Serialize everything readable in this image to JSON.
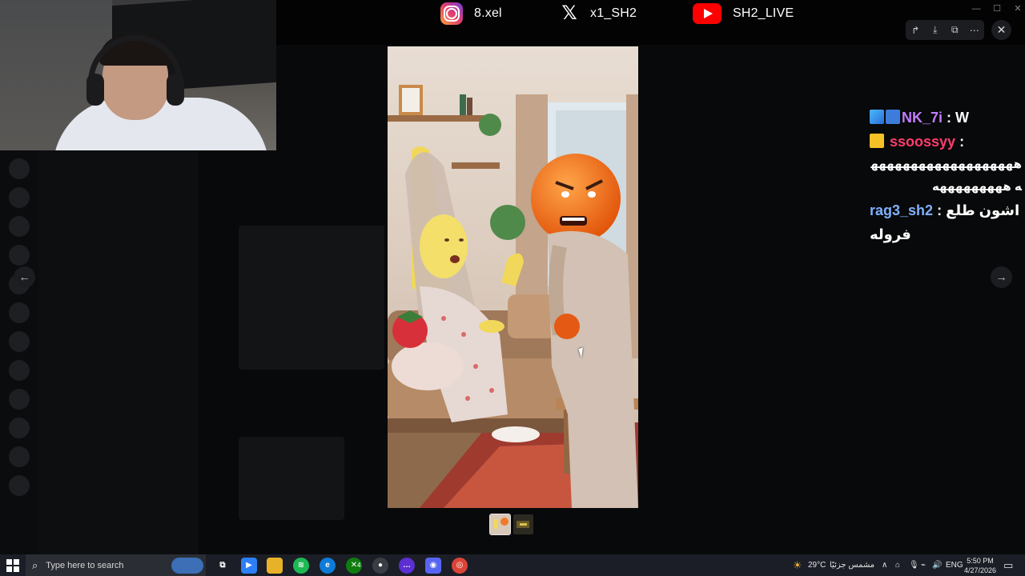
{
  "social": {
    "instagram": {
      "icon": "instagram-icon",
      "handle": "8.xel"
    },
    "x": {
      "icon": "x-twitter-icon",
      "handle": "x1_SH2"
    },
    "youtube": {
      "icon": "youtube-icon",
      "handle": "SH2_LIVE"
    }
  },
  "viewer": {
    "toolbar": [
      {
        "icon": "forward-icon",
        "glyph": "↱"
      },
      {
        "icon": "download-icon",
        "glyph": "⤓"
      },
      {
        "icon": "open-external-icon",
        "glyph": "⧉"
      },
      {
        "icon": "more-icon",
        "glyph": "⋯"
      }
    ],
    "close_glyph": "✕",
    "prev_glyph": "←",
    "next_glyph": "→"
  },
  "chat": [
    {
      "user": "NK_7i",
      "separator": " : ",
      "message": "W"
    },
    {
      "user": "ssoossyy",
      "separator": " :",
      "message": "هههههههههههههههههههه هههههههههه"
    },
    {
      "user": "rag3_sh2",
      "separator": " : ",
      "message": "اشون طلع فروله"
    }
  ],
  "taskbar": {
    "search_placeholder": "Type here to search",
    "weather_temp": "29°C",
    "weather_text": "مشمس جزئيًا",
    "language": "ENG",
    "time": "5:50 PM",
    "date": "4/27/2026",
    "badge_count": "4"
  },
  "colors": {
    "accent_discord": "#5865f2",
    "chat_name1": "#c27cff",
    "chat_name2": "#ff3c6e",
    "chat_name3": "#7fb1ff"
  }
}
